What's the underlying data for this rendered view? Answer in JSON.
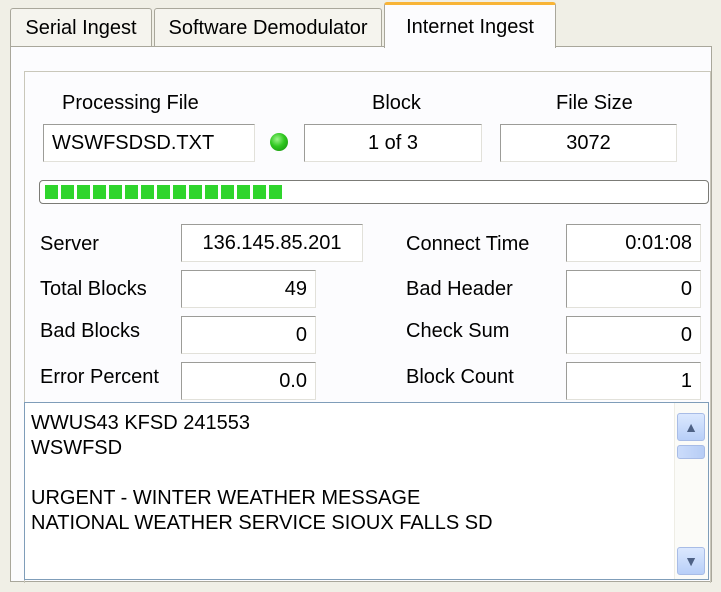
{
  "tabs": [
    {
      "label": "Serial Ingest",
      "active": false
    },
    {
      "label": "Software Demodulator",
      "active": false
    },
    {
      "label": "Internet Ingest",
      "active": true
    }
  ],
  "file_info": {
    "processing_file_label": "Processing File",
    "processing_file_value": "WSWFSDSD.TXT",
    "status_led_color": "#2fc71f",
    "block_label": "Block",
    "block_value": "1 of 3",
    "file_size_label": "File Size",
    "file_size_value": "3072"
  },
  "progress": {
    "fraction": 0.36,
    "color": "#2fd52c"
  },
  "stats": {
    "server_label": "Server",
    "server_value": "136.145.85.201",
    "total_blocks_label": "Total Blocks",
    "total_blocks_value": "49",
    "bad_blocks_label": "Bad Blocks",
    "bad_blocks_value": "0",
    "error_percent_label": "Error Percent",
    "error_percent_value": "0.0",
    "connect_time_label": "Connect Time",
    "connect_time_value": "0:01:08",
    "bad_header_label": "Bad Header",
    "bad_header_value": "0",
    "check_sum_label": "Check Sum",
    "check_sum_value": "0",
    "block_count_label": "Block Count",
    "block_count_value": "1"
  },
  "message_text": "WWUS43 KFSD 241553\nWSWFSD\n\nURGENT - WINTER WEATHER MESSAGE\nNATIONAL WEATHER SERVICE SIOUX FALLS SD",
  "scrollbar": {
    "up_icon": "▲",
    "down_icon": "▼"
  }
}
